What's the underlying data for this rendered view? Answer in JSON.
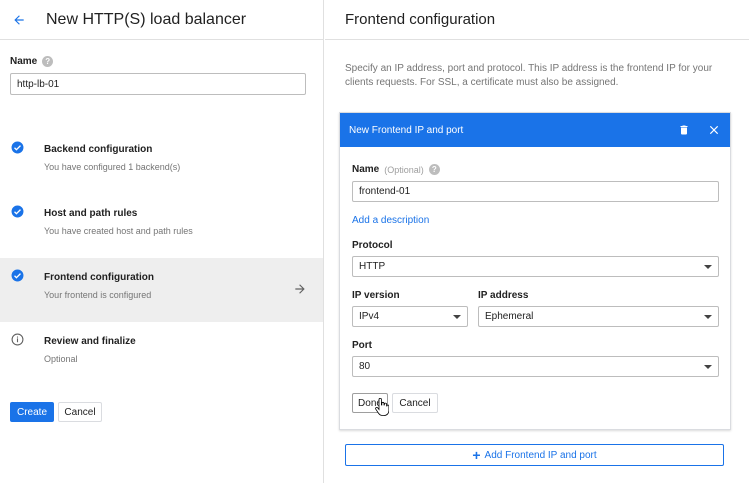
{
  "left": {
    "title": "New HTTP(S) load balancer",
    "name_label": "Name",
    "name_value": "http-lb-01",
    "steps": [
      {
        "title": "Backend configuration",
        "subtitle": "You have configured 1 backend(s)",
        "status": "done"
      },
      {
        "title": "Host and path rules",
        "subtitle": "You have created host and path rules",
        "status": "done"
      },
      {
        "title": "Frontend configuration",
        "subtitle": "Your frontend is configured",
        "status": "done",
        "active": true
      },
      {
        "title": "Review and finalize",
        "subtitle": "Optional",
        "status": "info"
      }
    ],
    "create_label": "Create",
    "cancel_label": "Cancel"
  },
  "right": {
    "title": "Frontend configuration",
    "description": "Specify an IP address, port and protocol. This IP address is the frontend IP for your clients requests. For SSL, a certificate must also be assigned.",
    "card": {
      "title": "New Frontend IP and port",
      "name_label": "Name",
      "name_optional": "(Optional)",
      "name_value": "frontend-01",
      "add_description": "Add a description",
      "protocol_label": "Protocol",
      "protocol_value": "HTTP",
      "ip_version_label": "IP version",
      "ip_version_value": "IPv4",
      "ip_address_label": "IP address",
      "ip_address_value": "Ephemeral",
      "port_label": "Port",
      "port_value": "80",
      "done_label": "Done",
      "cancel_label": "Cancel"
    },
    "add_frontend_label": "Add Frontend IP and port"
  },
  "colors": {
    "accent": "#1a73e8",
    "active_row": "#eeeeee"
  },
  "icons": {
    "back": "arrow-left-icon",
    "check": "check-circle-icon",
    "info": "info-circle-icon",
    "forward": "arrow-right-icon",
    "trash": "trash-icon",
    "close": "close-icon",
    "help": "help-circle-icon",
    "plus": "plus-icon"
  }
}
